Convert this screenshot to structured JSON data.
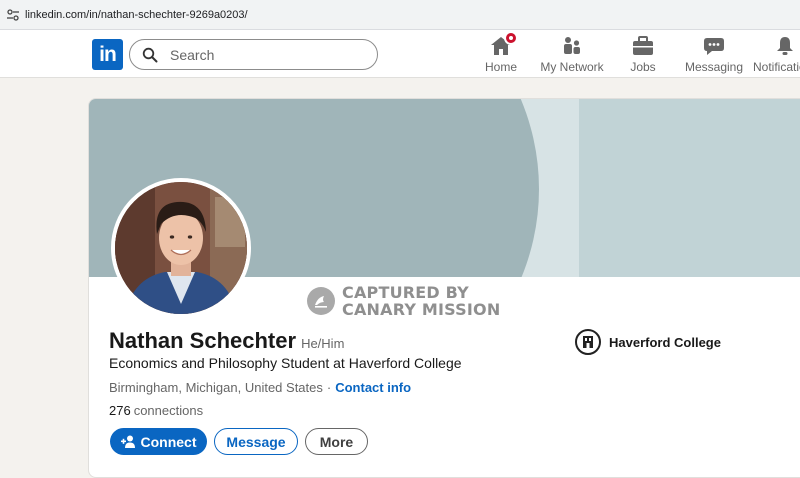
{
  "browser": {
    "url": "linkedin.com/in/nathan-schechter-9269a0203/",
    "site_info_icon": "tune-icon"
  },
  "header": {
    "logo": "in",
    "search": {
      "placeholder": "Search",
      "value": ""
    },
    "nav": [
      {
        "label": "Home",
        "icon": "home-icon",
        "has_badge": true
      },
      {
        "label": "My Network",
        "icon": "network-icon",
        "has_badge": false
      },
      {
        "label": "Jobs",
        "icon": "briefcase-icon",
        "has_badge": false
      },
      {
        "label": "Messaging",
        "icon": "chat-icon",
        "has_badge": false
      },
      {
        "label": "Notifications",
        "icon": "bell-icon",
        "has_badge": false
      }
    ]
  },
  "profile": {
    "name": "Nathan Schechter",
    "pronouns": "He/Him",
    "headline": "Economics and Philosophy Student at Haverford College",
    "location": "Birmingham, Michigan, United States",
    "separator": "·",
    "contact_info": "Contact info",
    "connections_count": "276",
    "connections_label": "connections",
    "school": "Haverford College",
    "buttons": {
      "connect": "Connect",
      "message": "Message",
      "more": "More"
    }
  },
  "watermark": {
    "line1": "CAPTURED BY",
    "line2": "CANARY MISSION"
  },
  "colors": {
    "brand": "#0a66c2",
    "badge": "#cb112d",
    "banner": "#c1d3d6",
    "banner_arc": "#a0b5b9"
  }
}
